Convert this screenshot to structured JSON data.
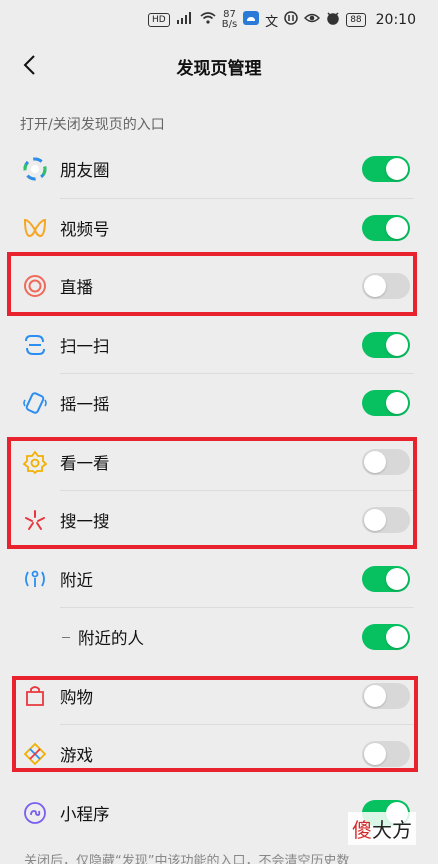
{
  "status_bar": {
    "network_speed": "87",
    "network_unit": "B/s",
    "battery": "88",
    "time": "20:10"
  },
  "nav": {
    "title": "发现页管理"
  },
  "section_label": "打开/关闭发现页的入口",
  "items": [
    {
      "label": "朋友圈",
      "icon": "moments-icon",
      "on": true
    },
    {
      "label": "视频号",
      "icon": "channels-icon",
      "on": true
    },
    {
      "label": "直播",
      "icon": "live-icon",
      "on": false
    },
    {
      "label": "扫一扫",
      "icon": "scan-icon",
      "on": true
    },
    {
      "label": "摇一摇",
      "icon": "shake-icon",
      "on": true
    },
    {
      "label": "看一看",
      "icon": "top-stories-icon",
      "on": false
    },
    {
      "label": "搜一搜",
      "icon": "search-icon",
      "on": false
    },
    {
      "label": "附近",
      "icon": "nearby-icon",
      "on": true
    },
    {
      "label": "附近的人",
      "icon": "",
      "on": true
    },
    {
      "label": "购物",
      "icon": "shopping-icon",
      "on": false
    },
    {
      "label": "游戏",
      "icon": "games-icon",
      "on": false
    },
    {
      "label": "小程序",
      "icon": "mini-programs-icon",
      "on": true
    }
  ],
  "footer_text": "关闭后，仅隐藏“发现”中该功能的入口，不会清空历史数",
  "watermark": {
    "part1": "傻",
    "part2": "大方"
  },
  "colors": {
    "toggle_on": "#07c160",
    "toggle_off": "#d8d8d8",
    "highlight": "#e8232d"
  }
}
